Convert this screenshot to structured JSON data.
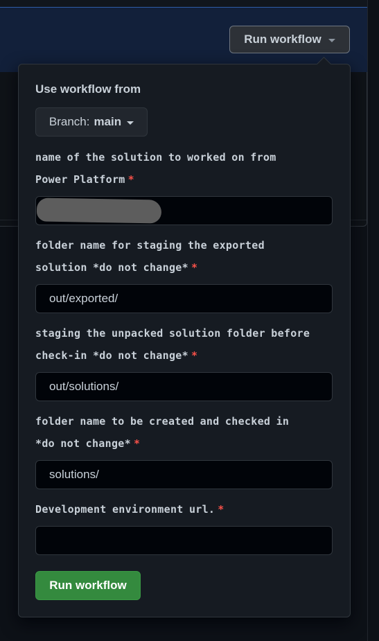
{
  "header": {
    "run_workflow_label": "Run workflow"
  },
  "popover": {
    "use_workflow_from_label": "Use workflow from",
    "branch": {
      "prefix": "Branch:",
      "name": "main"
    },
    "fields": [
      {
        "label_line1": "name of the solution to worked on from",
        "label_line2": "Power Platform",
        "required_marker": "*",
        "value": "",
        "redacted": true
      },
      {
        "label_line1": "folder name for staging the exported",
        "label_line2": "solution *do not change*",
        "required_marker": "*",
        "value": "out/exported/"
      },
      {
        "label_line1": "staging the unpacked solution folder before",
        "label_line2": "check-in *do not change*",
        "required_marker": "*",
        "value": "out/solutions/"
      },
      {
        "label_line1": "folder name to be created and checked in",
        "label_line2": "*do not change*",
        "required_marker": "*",
        "value": "solutions/"
      },
      {
        "label_line1": "Development environment url.",
        "required_marker": "*",
        "value": ""
      }
    ],
    "submit_label": "Run workflow"
  },
  "colors": {
    "background": "#0d1117",
    "popover_bg": "#161b22",
    "border": "#30363d",
    "input_bg": "#010409",
    "required": "#f85149",
    "primary_button": "#348a3e",
    "banner": "#12203a"
  }
}
